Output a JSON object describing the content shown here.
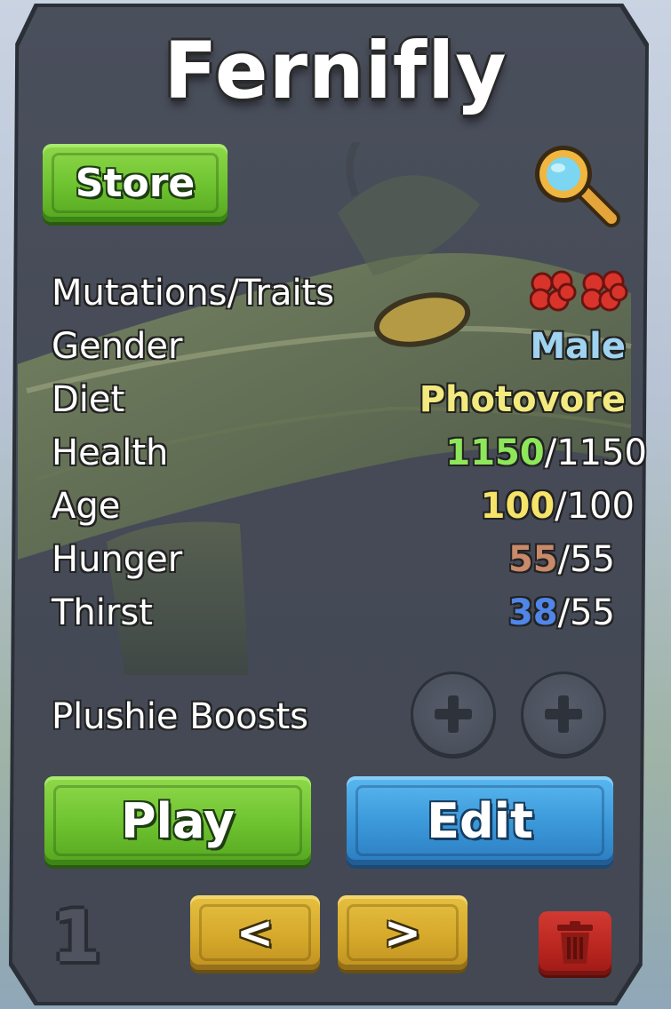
{
  "card": {
    "title": "Fernifly",
    "store_label": "Store"
  },
  "stats": {
    "mutations": {
      "label": "Mutations/Traits",
      "icon_count": 2,
      "icon": "red-mutation-icon",
      "color": "#d9342b"
    },
    "gender": {
      "label": "Gender",
      "value": "Male",
      "color": "#9fd3f0"
    },
    "diet": {
      "label": "Diet",
      "value": "Photovore",
      "color": "#f2ea7e"
    },
    "health": {
      "label": "Health",
      "current": "1150",
      "max": "/1150",
      "color": "#8ee65a"
    },
    "age": {
      "label": "Age",
      "current": "100",
      "max": "/100",
      "color": "#f5e36a"
    },
    "hunger": {
      "label": "Hunger",
      "current": "55",
      "max": "/55",
      "color": "#c88a6a"
    },
    "thirst": {
      "label": "Thirst",
      "current": "38",
      "max": "/55",
      "color": "#4f86e8"
    }
  },
  "plushie": {
    "label": "Plushie Boosts",
    "slots": [
      "empty",
      "empty"
    ]
  },
  "actions": {
    "play_label": "Play",
    "edit_label": "Edit"
  },
  "footer": {
    "slot_number": "1",
    "prev_label": "<",
    "next_label": ">"
  },
  "colors": {
    "panel": "#454a56",
    "green_button": "#6dc22f",
    "blue_button": "#3a97d8",
    "yellow_button": "#d6a92b",
    "red_button": "#b8251f"
  }
}
